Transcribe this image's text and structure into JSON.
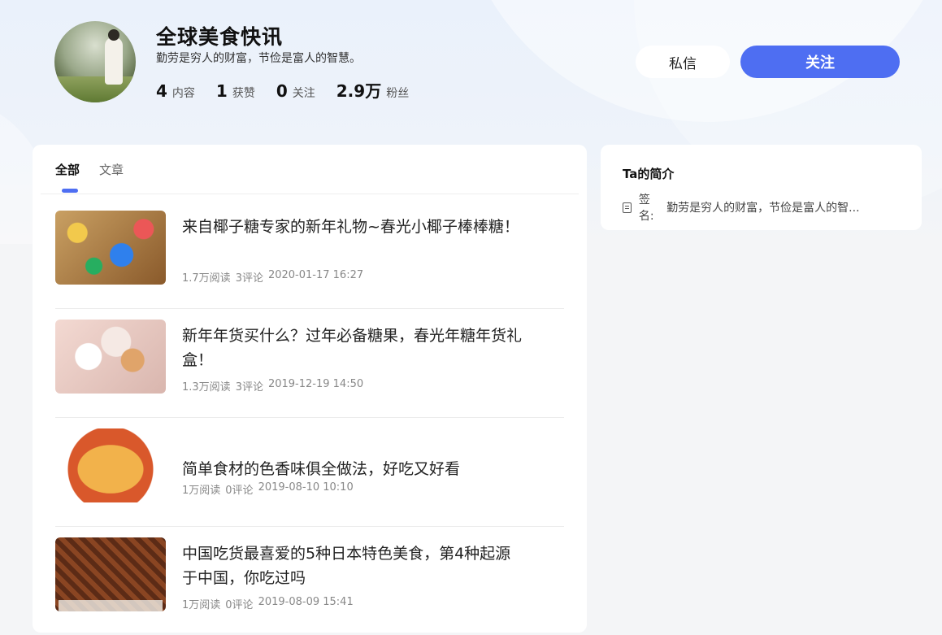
{
  "profile": {
    "name": "全球美食快讯",
    "bio": "勤劳是穷人的财富，节俭是富人的智慧。",
    "stats": [
      {
        "num": "4",
        "label": "内容"
      },
      {
        "num": "1",
        "label": "获赞"
      },
      {
        "num": "0",
        "label": "关注"
      },
      {
        "num": "2.9万",
        "label": "粉丝"
      }
    ]
  },
  "actions": {
    "message_label": "私信",
    "follow_label": "关注"
  },
  "colors": {
    "accent": "#4e6ef2"
  },
  "tabs": [
    {
      "label": "全部",
      "active": true
    },
    {
      "label": "文章",
      "active": false
    }
  ],
  "articles": [
    {
      "title": "来自椰子糖专家的新年礼物~春光小椰子棒棒糖！",
      "reads": "1.7万阅读",
      "comments": "3评论",
      "date": "2020-01-17 16:27"
    },
    {
      "title": "新年年货买什么？过年必备糖果，春光年糖年货礼盒！",
      "reads": "1.3万阅读",
      "comments": "3评论",
      "date": "2019-12-19 14:50"
    },
    {
      "title": "简单食材的色香味俱全做法，好吃又好看",
      "reads": "1万阅读",
      "comments": "0评论",
      "date": "2019-08-10 10:10"
    },
    {
      "title": "中国吃货最喜爱的5种日本特色美食，第4种起源于中国，你吃过吗",
      "reads": "1万阅读",
      "comments": "0评论",
      "date": "2019-08-09 15:41"
    }
  ],
  "intro": {
    "title": "Ta的简介",
    "sign_label": "签名:",
    "sign_text": "勤劳是穷人的财富，节俭是富人的智..."
  },
  "icons": {
    "sign": "document-icon"
  }
}
